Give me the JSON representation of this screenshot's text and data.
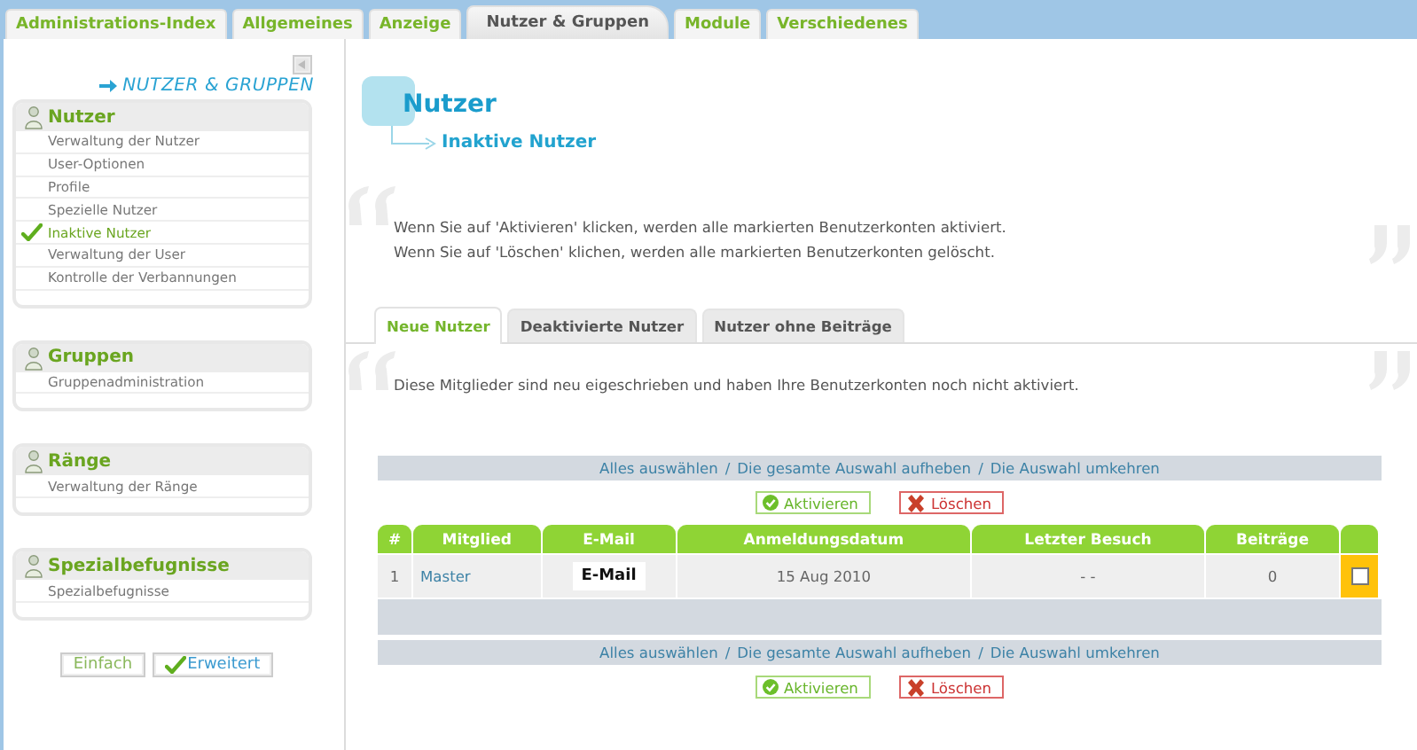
{
  "top_tabs": [
    {
      "label": "Administrations-Index",
      "selected": false
    },
    {
      "label": "Allgemeines",
      "selected": false
    },
    {
      "label": "Anzeige",
      "selected": false
    },
    {
      "label": "Nutzer & Gruppen",
      "selected": true
    },
    {
      "label": "Module",
      "selected": false
    },
    {
      "label": "Verschiedenes",
      "selected": false
    }
  ],
  "sidebar": {
    "heading": "NUTZER & GRUPPEN",
    "sections": [
      {
        "title": "Nutzer",
        "items": [
          {
            "label": "Verwaltung der Nutzer",
            "selected": false
          },
          {
            "label": "User-Optionen",
            "selected": false
          },
          {
            "label": "Profile",
            "selected": false
          },
          {
            "label": "Spezielle Nutzer",
            "selected": false
          },
          {
            "label": "Inaktive Nutzer",
            "selected": true
          },
          {
            "label": "Verwaltung der User",
            "selected": false
          },
          {
            "label": "Kontrolle der Verbannungen",
            "selected": false
          }
        ]
      },
      {
        "title": "Gruppen",
        "items": [
          {
            "label": "Gruppenadministration",
            "selected": false
          }
        ]
      },
      {
        "title": "Ränge",
        "items": [
          {
            "label": "Verwaltung der Ränge",
            "selected": false
          }
        ]
      },
      {
        "title": "Spezialbefugnisse",
        "items": [
          {
            "label": "Spezialbefugnisse",
            "selected": false
          }
        ]
      }
    ],
    "mode_buttons": [
      {
        "label": "Einfach",
        "selected": false
      },
      {
        "label": "Erweitert",
        "selected": true
      }
    ]
  },
  "main": {
    "title": "Nutzer",
    "subtitle": "Inaktive Nutzer",
    "intro": [
      "Wenn Sie auf 'Aktivieren' klicken, werden alle markierten Benutzerkonten aktiviert.",
      "Wenn Sie auf 'Löschen' klichen, werden alle markierten Benutzerkonten gelöscht."
    ],
    "tabs": [
      {
        "label": "Neue Nutzer",
        "selected": true
      },
      {
        "label": "Deaktivierte Nutzer",
        "selected": false
      },
      {
        "label": "Nutzer ohne Beiträge",
        "selected": false
      }
    ],
    "tab_description": "Diese Mitglieder sind neu eigeschrieben und haben Ihre Benutzerkonten noch nicht aktiviert.",
    "select_bar_top": {
      "links": [
        "Alles auswählen",
        "Die gesamte Auswahl aufheben",
        "Die Auswahl umkehren"
      ],
      "separator": "/"
    },
    "actions_top": [
      {
        "label": "Aktivieren",
        "kind": "activate"
      },
      {
        "label": "Löschen",
        "kind": "delete"
      }
    ],
    "table": {
      "columns": [
        "#",
        "Mitglied",
        "E-Mail",
        "Anmeldungsdatum",
        "Letzter Besuch",
        "Beiträge"
      ],
      "rows": [
        {
          "cells": [
            "1",
            "Master",
            "E-Mail",
            "15 Aug 2010",
            "- -",
            "0"
          ],
          "checked": false
        }
      ]
    },
    "select_bar_bottom": {
      "links": [
        "Alles auswählen",
        "Die gesamte Auswahl aufheben",
        "Die Auswahl umkehren"
      ],
      "separator": "/"
    },
    "actions_bottom": [
      {
        "label": "Aktivieren",
        "kind": "activate"
      },
      {
        "label": "Löschen",
        "kind": "delete"
      }
    ]
  }
}
